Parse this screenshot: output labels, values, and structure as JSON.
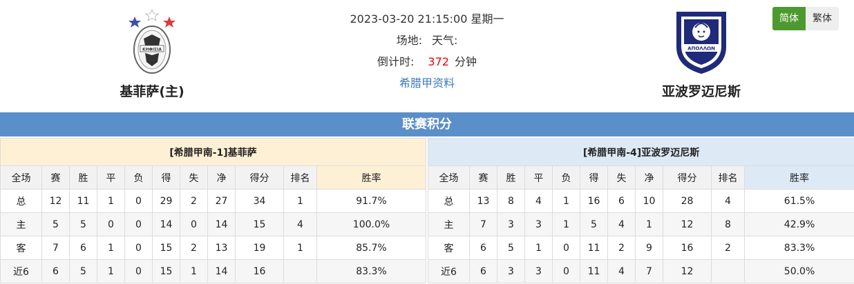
{
  "match": {
    "datetime": "2023-03-20 21:15:00 星期一",
    "venue_label": "场地:",
    "weather_label": "天气:",
    "countdown_label": "倒计时:",
    "countdown_value": "372",
    "countdown_unit": "分钟",
    "league_link": "希腊甲资料"
  },
  "home_team": {
    "name": "基菲萨(主)",
    "logo_text": "ΚΗΦΙΣΙΑ"
  },
  "away_team": {
    "name": "亚波罗迈尼斯",
    "logo_text": "ΑΠΟΛΛΩΝ"
  },
  "lang": {
    "simplified": "简体",
    "traditional": "繁体"
  },
  "section_title": "联赛积分",
  "columns": [
    "全场",
    "赛",
    "胜",
    "平",
    "负",
    "得",
    "失",
    "净",
    "得分",
    "排名",
    "胜率"
  ],
  "home_table": {
    "title": "[希腊甲南-1]基菲萨",
    "rows": [
      [
        "总",
        "12",
        "11",
        "1",
        "0",
        "29",
        "2",
        "27",
        "34",
        "1",
        "91.7%"
      ],
      [
        "主",
        "5",
        "5",
        "0",
        "0",
        "14",
        "0",
        "14",
        "15",
        "4",
        "100.0%"
      ],
      [
        "客",
        "7",
        "6",
        "1",
        "0",
        "15",
        "2",
        "13",
        "19",
        "1",
        "85.7%"
      ],
      [
        "近6",
        "6",
        "5",
        "1",
        "0",
        "15",
        "1",
        "14",
        "16",
        "",
        "83.3%"
      ]
    ]
  },
  "away_table": {
    "title": "[希腊甲南-4]亚波罗迈尼斯",
    "rows": [
      [
        "总",
        "13",
        "8",
        "4",
        "1",
        "16",
        "6",
        "10",
        "28",
        "4",
        "61.5%"
      ],
      [
        "主",
        "7",
        "3",
        "3",
        "1",
        "5",
        "4",
        "1",
        "12",
        "8",
        "42.9%"
      ],
      [
        "客",
        "6",
        "5",
        "1",
        "0",
        "11",
        "2",
        "9",
        "16",
        "2",
        "83.3%"
      ],
      [
        "近6",
        "6",
        "3",
        "3",
        "0",
        "11",
        "4",
        "7",
        "12",
        "",
        "50.0%"
      ]
    ]
  },
  "colors": {
    "section_header": "#5b8fc9",
    "home_title_bg": "#fdf0d5",
    "away_title_bg": "#dde9f5",
    "countdown": "#e60012",
    "link": "#3d7bbd",
    "lang_active": "#4c9a2f"
  }
}
